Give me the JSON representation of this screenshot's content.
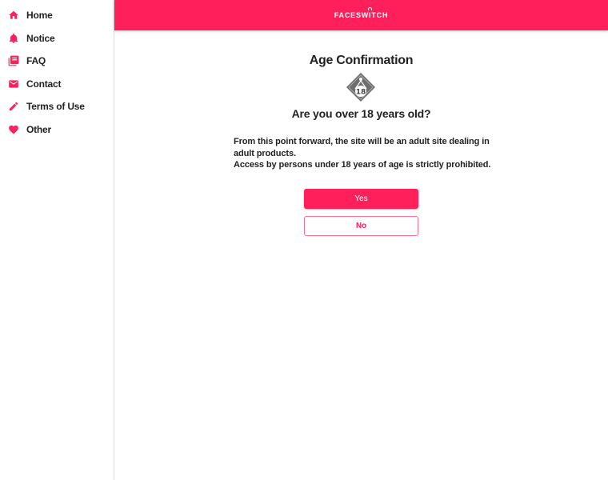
{
  "sidebar": {
    "items": [
      {
        "label": "Home",
        "icon": "home-icon"
      },
      {
        "label": "Notice",
        "icon": "bell-icon"
      },
      {
        "label": "FAQ",
        "icon": "book-icon"
      },
      {
        "label": "Contact",
        "icon": "mail-icon"
      },
      {
        "label": "Terms of Use",
        "icon": "pencil-icon"
      },
      {
        "label": "Other",
        "icon": "heart-icon"
      }
    ]
  },
  "header": {
    "logo_text": "FACESWITCH"
  },
  "main": {
    "title": "Age Confirmation",
    "badge_text": "18",
    "question": "Are you over 18 years old?",
    "notice_line1": "From this point forward, the site will be an adult site dealing in adult products.",
    "notice_line2": "Access by persons under 18 years of age is strictly prohibited.",
    "yes_label": "Yes",
    "no_label": "No"
  },
  "colors": {
    "accent": "#ff1f5a",
    "text": "#222222",
    "border": "#d9d9d9"
  }
}
